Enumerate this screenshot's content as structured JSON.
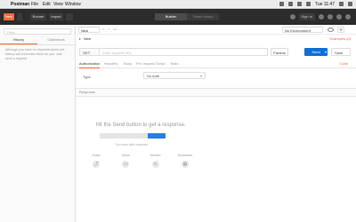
{
  "menubar": {
    "app_name": "Postman",
    "menus": [
      "File",
      "Edit",
      "View",
      "Window"
    ],
    "clock": "Tue 11:47"
  },
  "toolbar": {
    "new_label": "New",
    "runner_label": "Runner",
    "import_label": "Import",
    "tabs": [
      "Builder",
      "Team Library"
    ],
    "sign_in_label": "Sign In"
  },
  "sidebar": {
    "filter_placeholder": "Filter",
    "tabs": [
      "History",
      "Collections"
    ],
    "empty_text": "Although you have no requests saved yet, history will remember them for you. Just send a request."
  },
  "request_tabs": {
    "current_label": "New",
    "close_symbol": "×",
    "plus_symbol": "+",
    "more_symbol": "•••"
  },
  "environment": {
    "selected": "No Environment"
  },
  "request": {
    "name": "New",
    "examples_label": "Examples (0)",
    "method": "GET",
    "url_placeholder": "Enter request URL",
    "params_label": "Params",
    "send_label": "Send",
    "save_label": "Save",
    "subtabs": [
      "Authorization",
      "Headers",
      "Body",
      "Pre-request Script",
      "Tests"
    ],
    "code_label": "Code"
  },
  "auth": {
    "type_label": "Type",
    "type_value": "No Auth"
  },
  "response": {
    "label": "Response",
    "empty_title": "Hit the Send button to get a response.",
    "hint": "Do more with requests",
    "tips": [
      "Share",
      "Mock",
      "Monitor",
      "Document"
    ]
  }
}
